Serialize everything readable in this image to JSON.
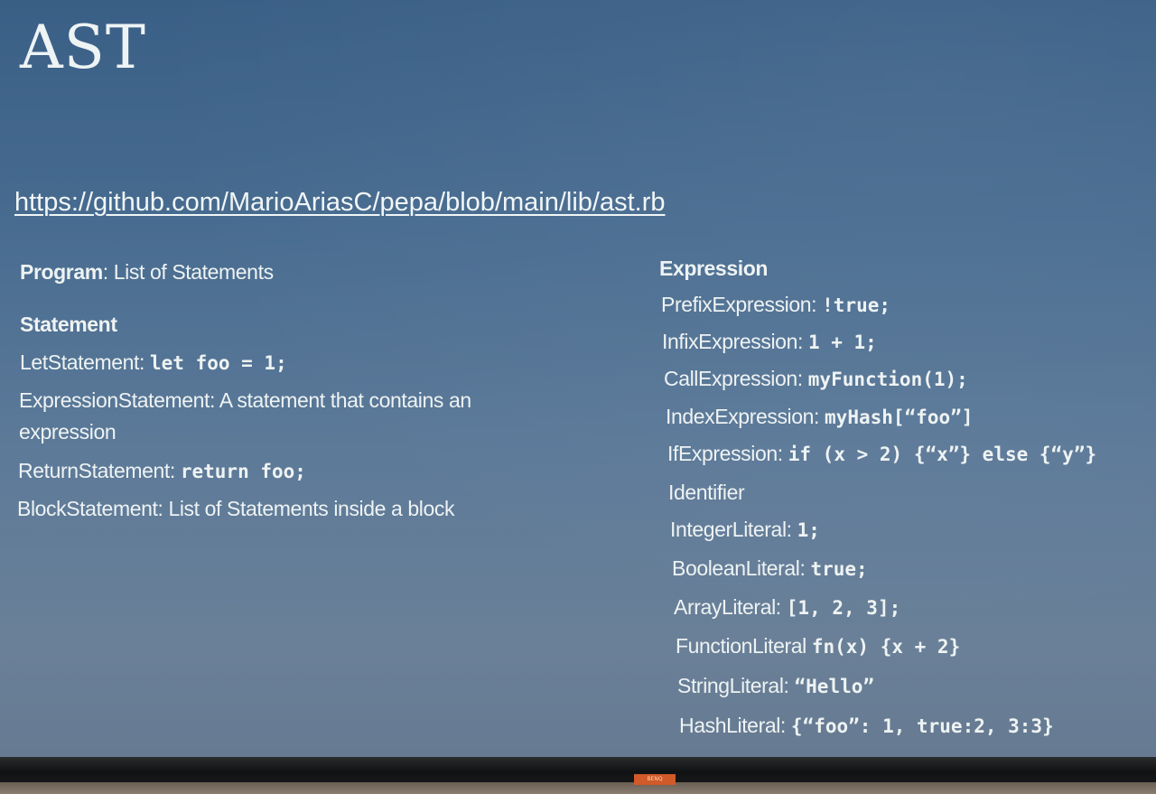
{
  "slide": {
    "title": "AST",
    "link": "https://github.com/MarioAriasC/pepa/blob/main/lib/ast.rb",
    "left": {
      "program_label": "Program",
      "program_text": ": List of Statements",
      "statement_heading": "Statement",
      "let_label": "LetStatement: ",
      "let_code": "let foo = 1;",
      "expr_stmt_text": "ExpressionStatement: A statement that contains an expression",
      "return_label": "ReturnStatement: ",
      "return_code": "return foo;",
      "block_text": "BlockStatement: List of Statements inside a block"
    },
    "right": {
      "expression_heading": "Expression",
      "items": [
        {
          "label": "PrefixExpression: ",
          "code": "!true;"
        },
        {
          "label": "InfixExpression: ",
          "code": "1 + 1;"
        },
        {
          "label": "CallExpression: ",
          "code": "myFunction(1);"
        },
        {
          "label": "IndexExpression: ",
          "code": "myHash[“foo”]"
        },
        {
          "label": "IfExpression: ",
          "code": "if (x > 2) {“x”} else {“y”}"
        },
        {
          "label": "Identifier",
          "code": ""
        },
        {
          "label": "IntegerLiteral: ",
          "code": "1;"
        },
        {
          "label": "BooleanLiteral: ",
          "code": "true;"
        },
        {
          "label": "ArrayLiteral: ",
          "code": "[1, 2, 3];"
        },
        {
          "label": "FunctionLiteral ",
          "code": "fn(x) {x + 2}"
        },
        {
          "label": "StringLiteral: ",
          "code": "“Hello”"
        },
        {
          "label": "HashLiteral: ",
          "code": "{“foo”: 1, true:2, 3:3}"
        }
      ]
    }
  },
  "monitor": {
    "badge_text": "BENQ",
    "colors": {
      "slide_top": "#3a5f86",
      "slide_bottom": "#667b92",
      "text": "#eef3f3"
    }
  }
}
